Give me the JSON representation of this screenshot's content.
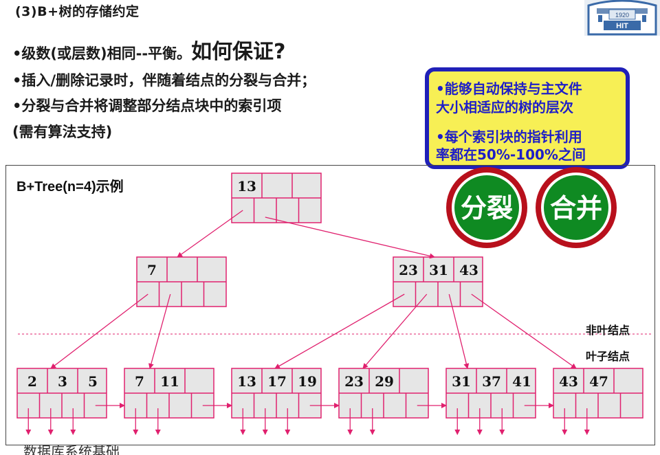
{
  "title": "(3)B+树的存储约定",
  "bullets": {
    "b1_pre": "•级数(或层数)相同--平衡。",
    "b1_big": "如何保证?",
    "b2": "•插入/删除记录时，伴随着结点的分裂与合并；",
    "b3": "•分裂与合并将调整部分结点块中的索引项",
    "b4": "(需有算法支持)"
  },
  "logo": {
    "year": "1920",
    "text": "HIT"
  },
  "callout": {
    "line1": "•能够自动保持与主文件",
    "line2": "大小相适应的树的层次",
    "line3": "•每个索引块的指针利用",
    "line4": "率都在50%-100%之间"
  },
  "buttons": {
    "split": "分裂",
    "merge": "合并"
  },
  "diagram": {
    "title": "B+Tree(n=4)示例",
    "label_nonleaf": "非叶结点",
    "label_leaf": "叶子结点",
    "nodes": [
      {
        "keys": [
          "13",
          "",
          ""
        ]
      },
      {
        "keys": [
          "7",
          "",
          ""
        ]
      },
      {
        "keys": [
          "23",
          "31",
          "43"
        ]
      },
      {
        "keys": [
          "2",
          "3",
          "5"
        ]
      },
      {
        "keys": [
          "7",
          "11",
          ""
        ]
      },
      {
        "keys": [
          "13",
          "17",
          "19"
        ]
      },
      {
        "keys": [
          "23",
          "29",
          ""
        ]
      },
      {
        "keys": [
          "31",
          "37",
          "41"
        ]
      },
      {
        "keys": [
          "43",
          "47",
          ""
        ]
      }
    ]
  },
  "footer": "数据库系统基础",
  "colors": {
    "pointer": "#e0206e",
    "node_fill": "#e6e6e6",
    "callout_bg": "#f7ef55",
    "callout_border": "#2020b8",
    "callout_text": "#1e1ec8",
    "button_green": "#0f8a22",
    "button_ring": "#b8101c"
  }
}
